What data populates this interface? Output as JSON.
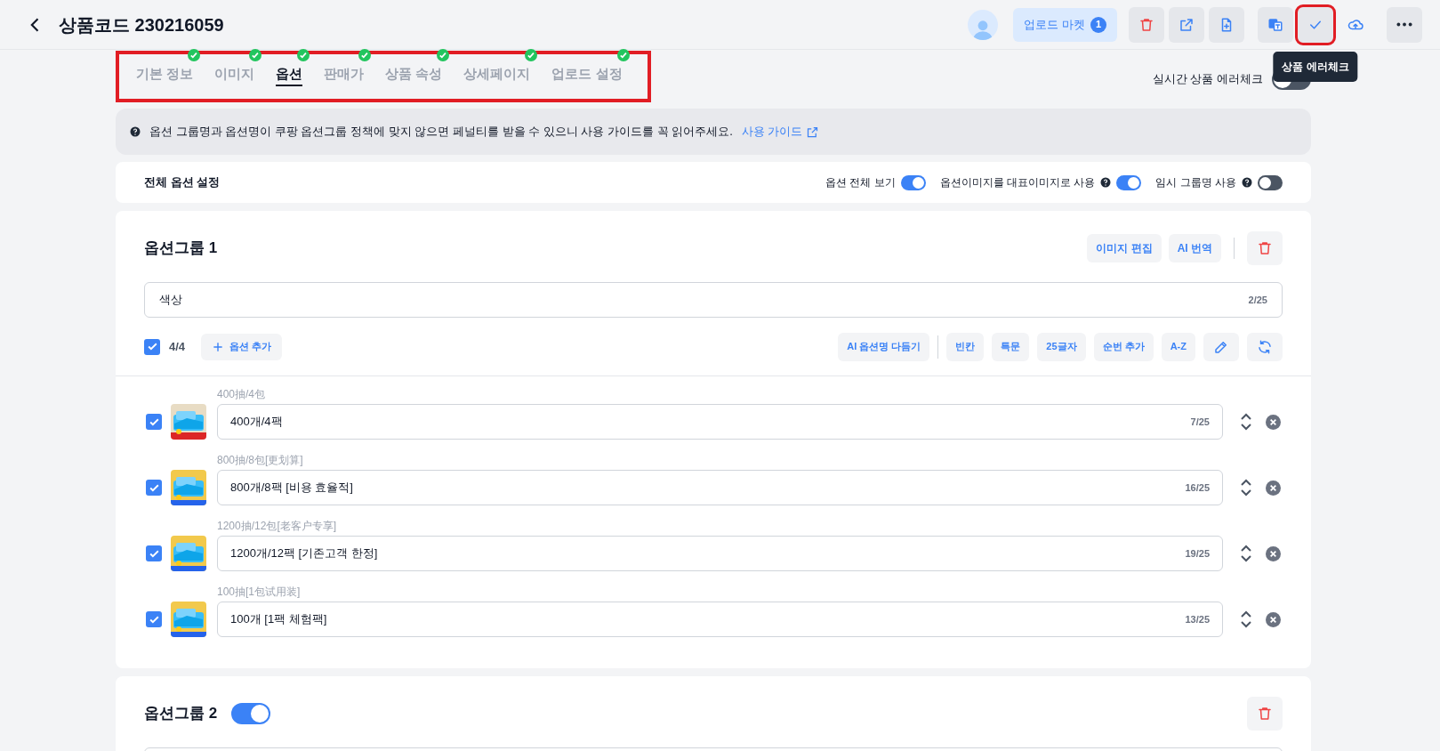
{
  "header": {
    "title": "상품코드 230216059",
    "upload_market": {
      "label": "업로드 마켓",
      "count": "1"
    },
    "toolbar": [
      {
        "kind": "delete",
        "highlighted": false
      },
      {
        "kind": "open",
        "highlighted": false
      },
      {
        "kind": "add-file",
        "highlighted": false
      },
      {
        "kind": "translate",
        "highlighted": false
      },
      {
        "kind": "check",
        "highlighted": true
      },
      {
        "kind": "upload",
        "highlighted": false
      },
      {
        "kind": "more",
        "highlighted": false
      }
    ],
    "tooltip": "상품 에러체크"
  },
  "tabs_highlighted": true,
  "tabs": [
    {
      "label": "기본 정보",
      "selected": false,
      "done": true
    },
    {
      "label": "이미지",
      "selected": false,
      "done": true
    },
    {
      "label": "옵션",
      "selected": true,
      "done": true
    },
    {
      "label": "판매가",
      "selected": false,
      "done": true
    },
    {
      "label": "상품 속성",
      "selected": false,
      "done": true
    },
    {
      "label": "상세페이지",
      "selected": false,
      "done": true
    },
    {
      "label": "업로드 설정",
      "selected": false,
      "done": true
    }
  ],
  "realtime_check": {
    "label": "실시간 상품 에러체크",
    "on": false
  },
  "notice": {
    "text": "옵션 그룹명과 옵션명이 쿠팡 옵션그룹 정책에 맞지 않으면 페널티를 받을 수 있으니 사용 가이드를 꼭 읽어주세요.",
    "link": "사용 가이드"
  },
  "global_settings": {
    "title": "전체 옵션 설정",
    "toggles": [
      {
        "label": "옵션 전체 보기",
        "help": false,
        "on": true
      },
      {
        "label": "옵션이미지를 대표이미지로 사용",
        "help": true,
        "on": true
      },
      {
        "label": "임시 그룹명 사용",
        "help": true,
        "on": false
      }
    ]
  },
  "groups": [
    {
      "title": "옵션그룹 1",
      "actions": [
        "이미지 편집",
        "AI 번역"
      ],
      "name_field": {
        "value": "색상",
        "counter": "2/25"
      },
      "select_all": {
        "checked": true,
        "count": "4/4"
      },
      "add_option": "옵션 추가",
      "tools": [
        {
          "kind": "text",
          "label": "AI 옵션명 다듬기"
        },
        {
          "kind": "divider"
        },
        {
          "kind": "text",
          "label": "빈칸"
        },
        {
          "kind": "text",
          "label": "특문"
        },
        {
          "kind": "text",
          "label": "25글자"
        },
        {
          "kind": "text",
          "label": "순번 추가"
        },
        {
          "kind": "text",
          "label": "A-Z"
        },
        {
          "kind": "edit"
        },
        {
          "kind": "refresh"
        }
      ],
      "options": [
        {
          "original": "400抽/4包",
          "value": "400개/4팩",
          "counter": "7/25",
          "checked": true
        },
        {
          "original": "800抽/8包[更划算]",
          "value": "800개/8팩 [비용 효율적]",
          "counter": "16/25",
          "checked": true
        },
        {
          "original": "1200抽/12包[老客户专享]",
          "value": "1200개/12팩 [기존고객 한정]",
          "counter": "19/25",
          "checked": true
        },
        {
          "original": "100抽[1包试用装]",
          "value": "100개 [1팩 체험팩]",
          "counter": "13/25",
          "checked": true
        }
      ]
    },
    {
      "title": "옵션그룹 2",
      "toggle_on": true
    }
  ]
}
